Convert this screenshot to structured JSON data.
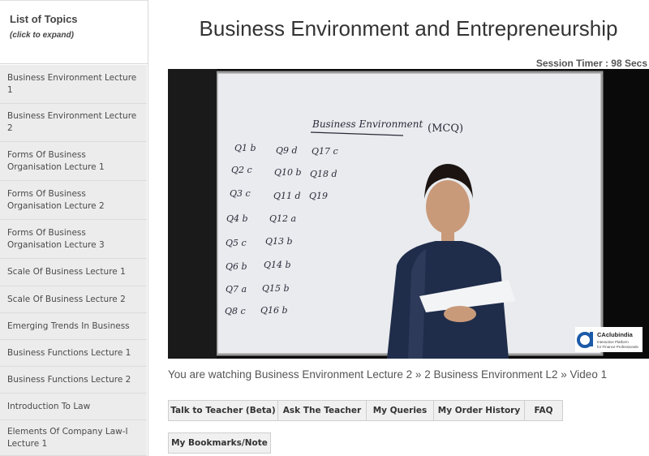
{
  "sidebar": {
    "heading": "List of Topics",
    "subheading": "(click to expand)",
    "items": [
      {
        "label": "Business Environment Lecture 1"
      },
      {
        "label": "Business Environment Lecture 2"
      },
      {
        "label": "Forms Of Business Organisation Lecture 1"
      },
      {
        "label": "Forms Of Business Organisation Lecture 2"
      },
      {
        "label": "Forms Of Business Organisation Lecture 3"
      },
      {
        "label": "Scale Of Business Lecture 1"
      },
      {
        "label": "Scale Of Business Lecture 2"
      },
      {
        "label": "Emerging Trends In Business"
      },
      {
        "label": "Business Functions Lecture 1"
      },
      {
        "label": "Business Functions Lecture 2"
      },
      {
        "label": "Introduction To Law"
      },
      {
        "label": "Elements Of Company Law-I Lecture 1"
      }
    ]
  },
  "main": {
    "title": "Business Environment and Entrepreneurship",
    "session_timer": "Session Timer : 98 Secs",
    "breadcrumb": "You are watching Business Environment Lecture 2 » 2 Business Environment L2 » Video 1"
  },
  "video": {
    "board_title": "Business Environment",
    "board_tag": "(MCQ)",
    "answers": [
      "Q1 b",
      "Q9 d",
      "Q17 c",
      "Q2 c",
      "Q10 b",
      "Q18 d",
      "Q3 c",
      "Q11 d",
      "Q19",
      "Q4 b",
      "Q12 a",
      "Q5 c",
      "Q13 b",
      "Q6 b",
      "Q14 b",
      "Q7 a",
      "Q15 b",
      "Q8 c",
      "Q16 b"
    ],
    "logo_name": "CAclubindia",
    "logo_tagline_1": "Interactive Platform",
    "logo_tagline_2": "for Finance Professionals"
  },
  "actions": {
    "talk_teacher": "Talk to Teacher (Beta)",
    "ask_teacher": "Ask The Teacher",
    "my_queries": "My Queries",
    "order_history": "My Order History",
    "faq": "FAQ",
    "bookmarks": "My Bookmarks/Note"
  }
}
